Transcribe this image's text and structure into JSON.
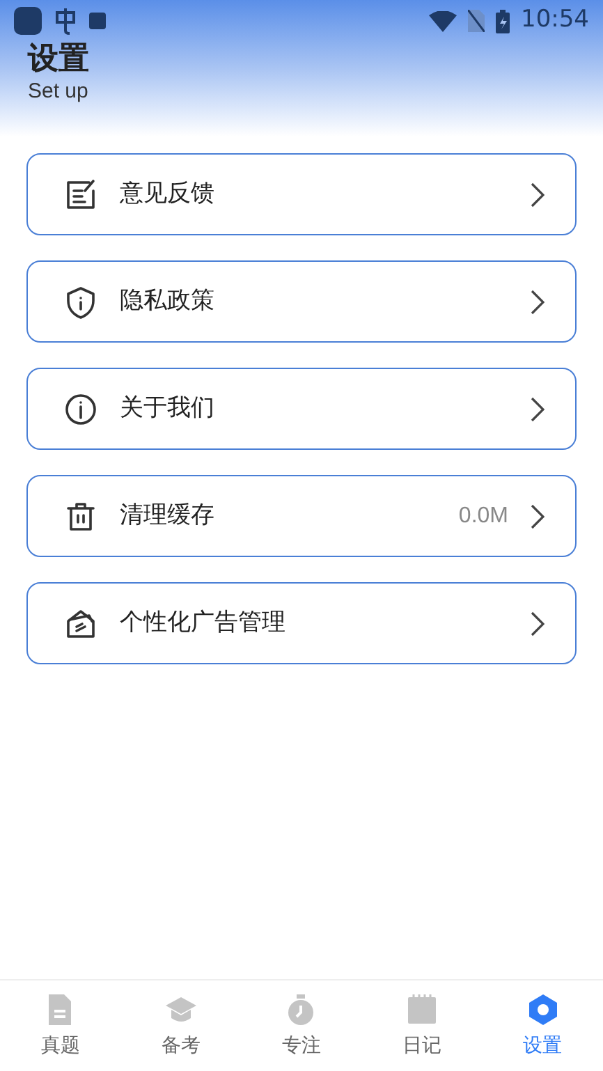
{
  "status_bar": {
    "time": "10:54"
  },
  "header": {
    "title": "设置",
    "subtitle": "Set up"
  },
  "menu": [
    {
      "kind": "feedback",
      "label": "意见反馈"
    },
    {
      "kind": "privacy",
      "label": "隐私政策"
    },
    {
      "kind": "about",
      "label": "关于我们"
    },
    {
      "kind": "cache",
      "label": "清理缓存",
      "value": "0.0M"
    },
    {
      "kind": "ads",
      "label": "个性化广告管理"
    }
  ],
  "tabs": [
    {
      "kind": "paper",
      "label": "真题",
      "selected": false
    },
    {
      "kind": "cap",
      "label": "备考",
      "selected": false
    },
    {
      "kind": "timer",
      "label": "专注",
      "selected": false
    },
    {
      "kind": "diary",
      "label": "日记",
      "selected": false
    },
    {
      "kind": "gear",
      "label": "设置",
      "selected": true
    }
  ]
}
